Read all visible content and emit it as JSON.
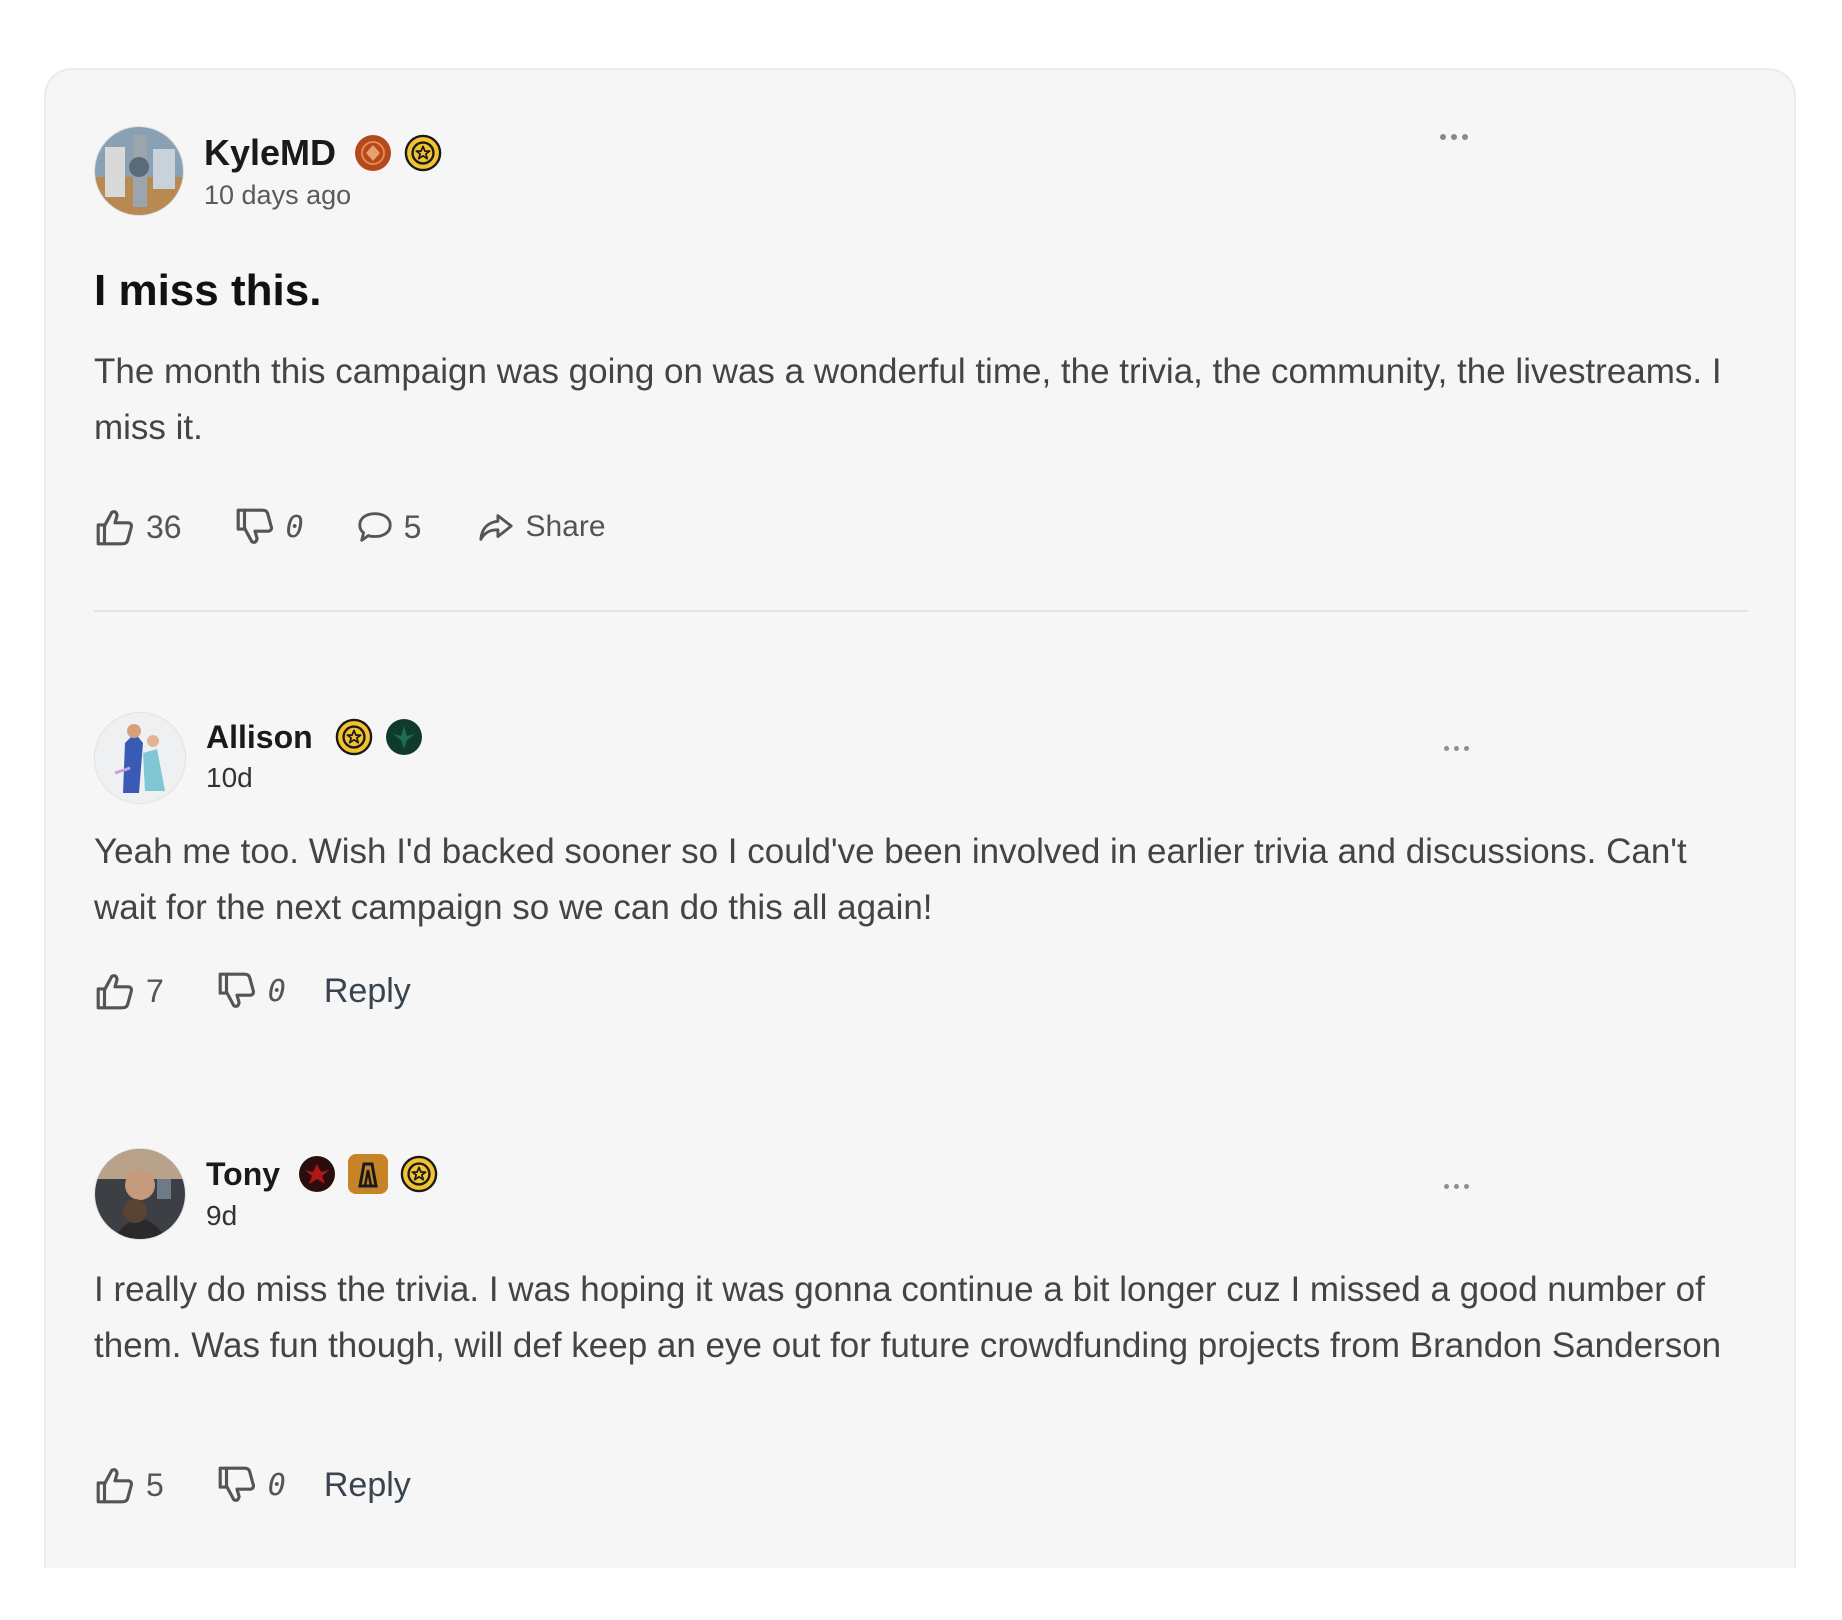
{
  "post": {
    "author": "KyleMD",
    "timestamp": "10 days ago",
    "title": "I miss this.",
    "body": "The month this campaign was going on was a wonderful time, the trivia, the community, the livestreams. I miss it.",
    "likes": "36",
    "dislikes": "0",
    "comments": "5",
    "share_label": "Share",
    "badges": [
      "orange-emblem-badge",
      "gold-star-badge"
    ]
  },
  "replies": [
    {
      "author": "Allison",
      "timestamp": "10d",
      "body": "Yeah me too. Wish I'd backed sooner so I could've been involved in earlier trivia and discussions. Can't wait for the next campaign so we can do this all again!",
      "likes": "7",
      "dislikes": "0",
      "reply_label": "Reply",
      "badges": [
        "gold-star-badge",
        "dark-green-emblem-badge"
      ]
    },
    {
      "author": "Tony",
      "timestamp": "9d",
      "body": "I really do miss the trivia. I was hoping it was gonna continue a bit longer cuz I missed a good number of them. Was fun though, will def keep an eye out for future crowdfunding projects from Brandon Sanderson",
      "likes": "5",
      "dislikes": "0",
      "reply_label": "Reply",
      "badges": [
        "red-emblem-badge",
        "orange-tower-badge",
        "gold-star-badge"
      ]
    }
  ],
  "colors": {
    "card_background": "#f6f6f6",
    "body_text": "#444444",
    "meta_text": "#5a5a5a",
    "gold_badge": "#f2c230",
    "orange_badge": "#b5481c"
  }
}
